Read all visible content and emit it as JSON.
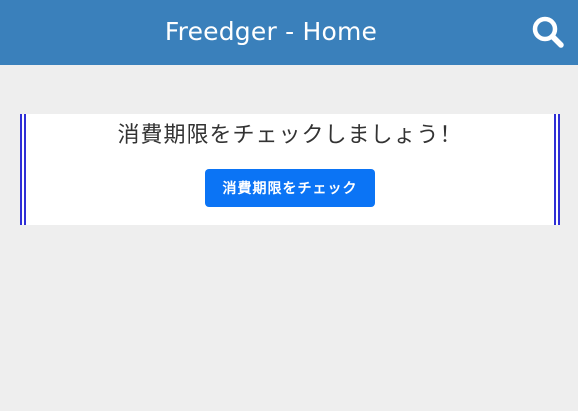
{
  "header": {
    "title": "Freedger - Home",
    "search_icon": "search-icon",
    "background_color": "#3a80bb"
  },
  "main": {
    "heading": "消費期限をチェックしましょう！",
    "check_button_label": "消費期限をチェック",
    "button_color": "#0b74f5",
    "accent_bar_color": "#2f2fd6"
  }
}
